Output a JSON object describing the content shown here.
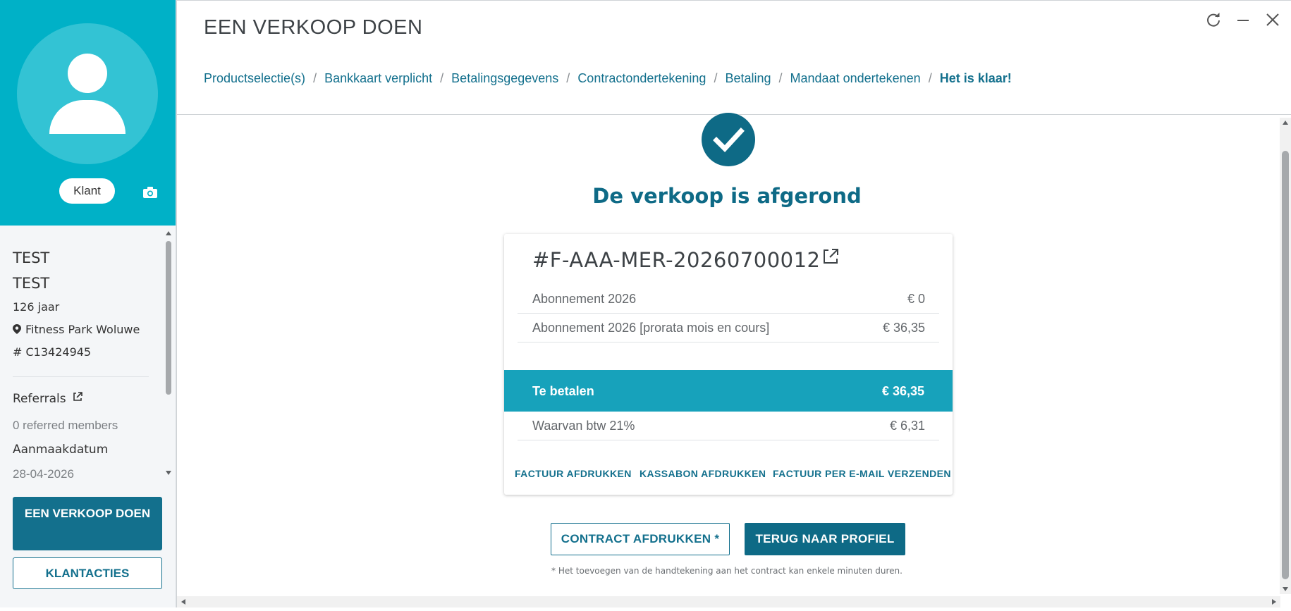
{
  "sidebar": {
    "role_label": "Klant",
    "first_name": "TEST",
    "last_name": "TEST",
    "age": "126 jaar",
    "club": "Fitness Park Woluwe",
    "customer_id": "# C13424945",
    "referrals_title": "Referrals",
    "referrals_value": "0 referred members",
    "created_title": "Aanmaakdatum",
    "created_value": "28-04-2026",
    "sale_button": "EEN VERKOOP DOEN",
    "actions_button": "KLANTACTIES"
  },
  "header": {
    "title": "EEN VERKOOP DOEN",
    "breadcrumb": [
      "Productselectie(s)",
      "Bankkaart verplicht",
      "Betalingsgegevens",
      "Contractondertekening",
      "Betaling",
      "Mandaat ondertekenen",
      "Het is klaar!"
    ],
    "separator": "/"
  },
  "main": {
    "done_title": "De verkoop is afgerond",
    "invoice": {
      "number": "#F-AAA-MER-20260700012",
      "lines": [
        {
          "label": "Abonnement 2026",
          "amount": "€ 0"
        },
        {
          "label": "Abonnement 2026 [prorata mois en cours]",
          "amount": "€ 36,35"
        }
      ],
      "total_label": "Te betalen",
      "total_amount": "€ 36,35",
      "vat_label": "Waarvan btw 21%",
      "vat_amount": "€ 6,31",
      "actions": [
        "FACTUUR AFDRUKKEN",
        "KASSABON AFDRUKKEN",
        "FACTUUR PER E-MAIL VERZENDEN"
      ]
    },
    "contract_button": "CONTRACT AFDRUKKEN *",
    "back_button": "TERUG NAAR PROFIEL",
    "footnote": "* Het toevoegen van de handtekening aan het contract kan enkele minuten duren."
  },
  "colors": {
    "accent": "#13708d",
    "profile_bg": "#00b1c7",
    "total_bar": "#17a2bb",
    "success": "#0e6a86"
  }
}
